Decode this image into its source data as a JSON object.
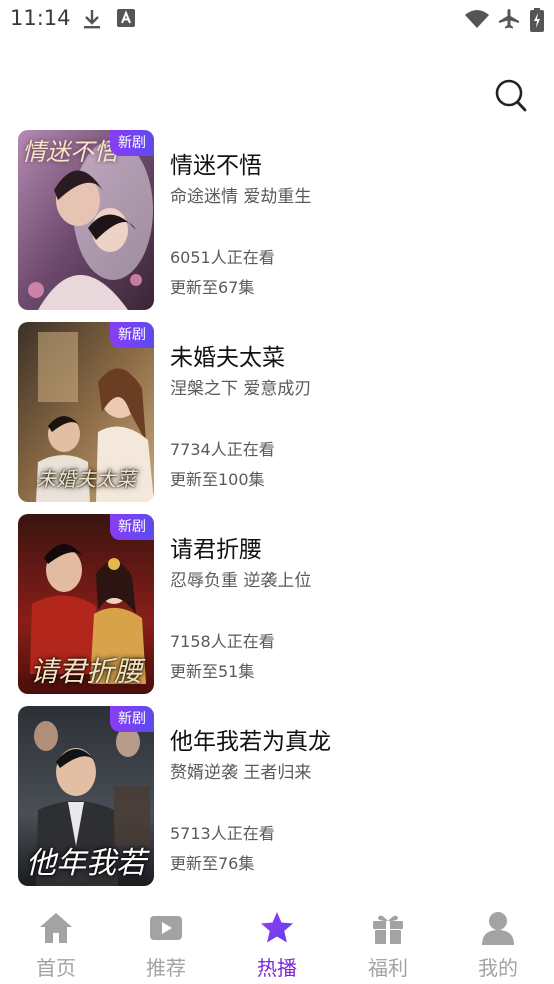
{
  "status_bar": {
    "time": "11:14",
    "icons": [
      "download-icon",
      "a-notification-icon",
      "wifi-icon",
      "airplane-mode-icon",
      "battery-charging-icon"
    ]
  },
  "header": {
    "search_icon": "search-icon"
  },
  "dramas": [
    {
      "title": "情迷不悟",
      "tagline": "命途迷情 爱劫重生",
      "watching": "6051人正在看",
      "episodes": "更新至67集",
      "badge": "新剧",
      "poster_text": "情迷不悟"
    },
    {
      "title": "未婚夫太菜",
      "tagline": "涅槃之下 爱意成刃",
      "watching": "7734人正在看",
      "episodes": "更新至100集",
      "badge": "新剧",
      "poster_text": "未婚夫太菜"
    },
    {
      "title": "请君折腰",
      "tagline": "忍辱负重 逆袭上位",
      "watching": "7158人正在看",
      "episodes": "更新至51集",
      "badge": "新剧",
      "poster_text": "请君折腰"
    },
    {
      "title": "他年我若为真龙",
      "tagline": "赘婿逆袭 王者归来",
      "watching": "5713人正在看",
      "episodes": "更新至76集",
      "badge": "新剧",
      "poster_text": "他年我若"
    }
  ],
  "bottom_nav": [
    {
      "label": "首页",
      "icon": "home-icon",
      "active": false
    },
    {
      "label": "推荐",
      "icon": "play-icon",
      "active": false
    },
    {
      "label": "热播",
      "icon": "star-icon",
      "active": true
    },
    {
      "label": "福利",
      "icon": "gift-icon",
      "active": false
    },
    {
      "label": "我的",
      "icon": "person-icon",
      "active": false
    }
  ],
  "colors": {
    "accent": "#7f26d8",
    "inactive_nav": "#a3a3a3",
    "badge_gradient_start": "#8a3cf5",
    "badge_gradient_end": "#5b4bf0"
  }
}
